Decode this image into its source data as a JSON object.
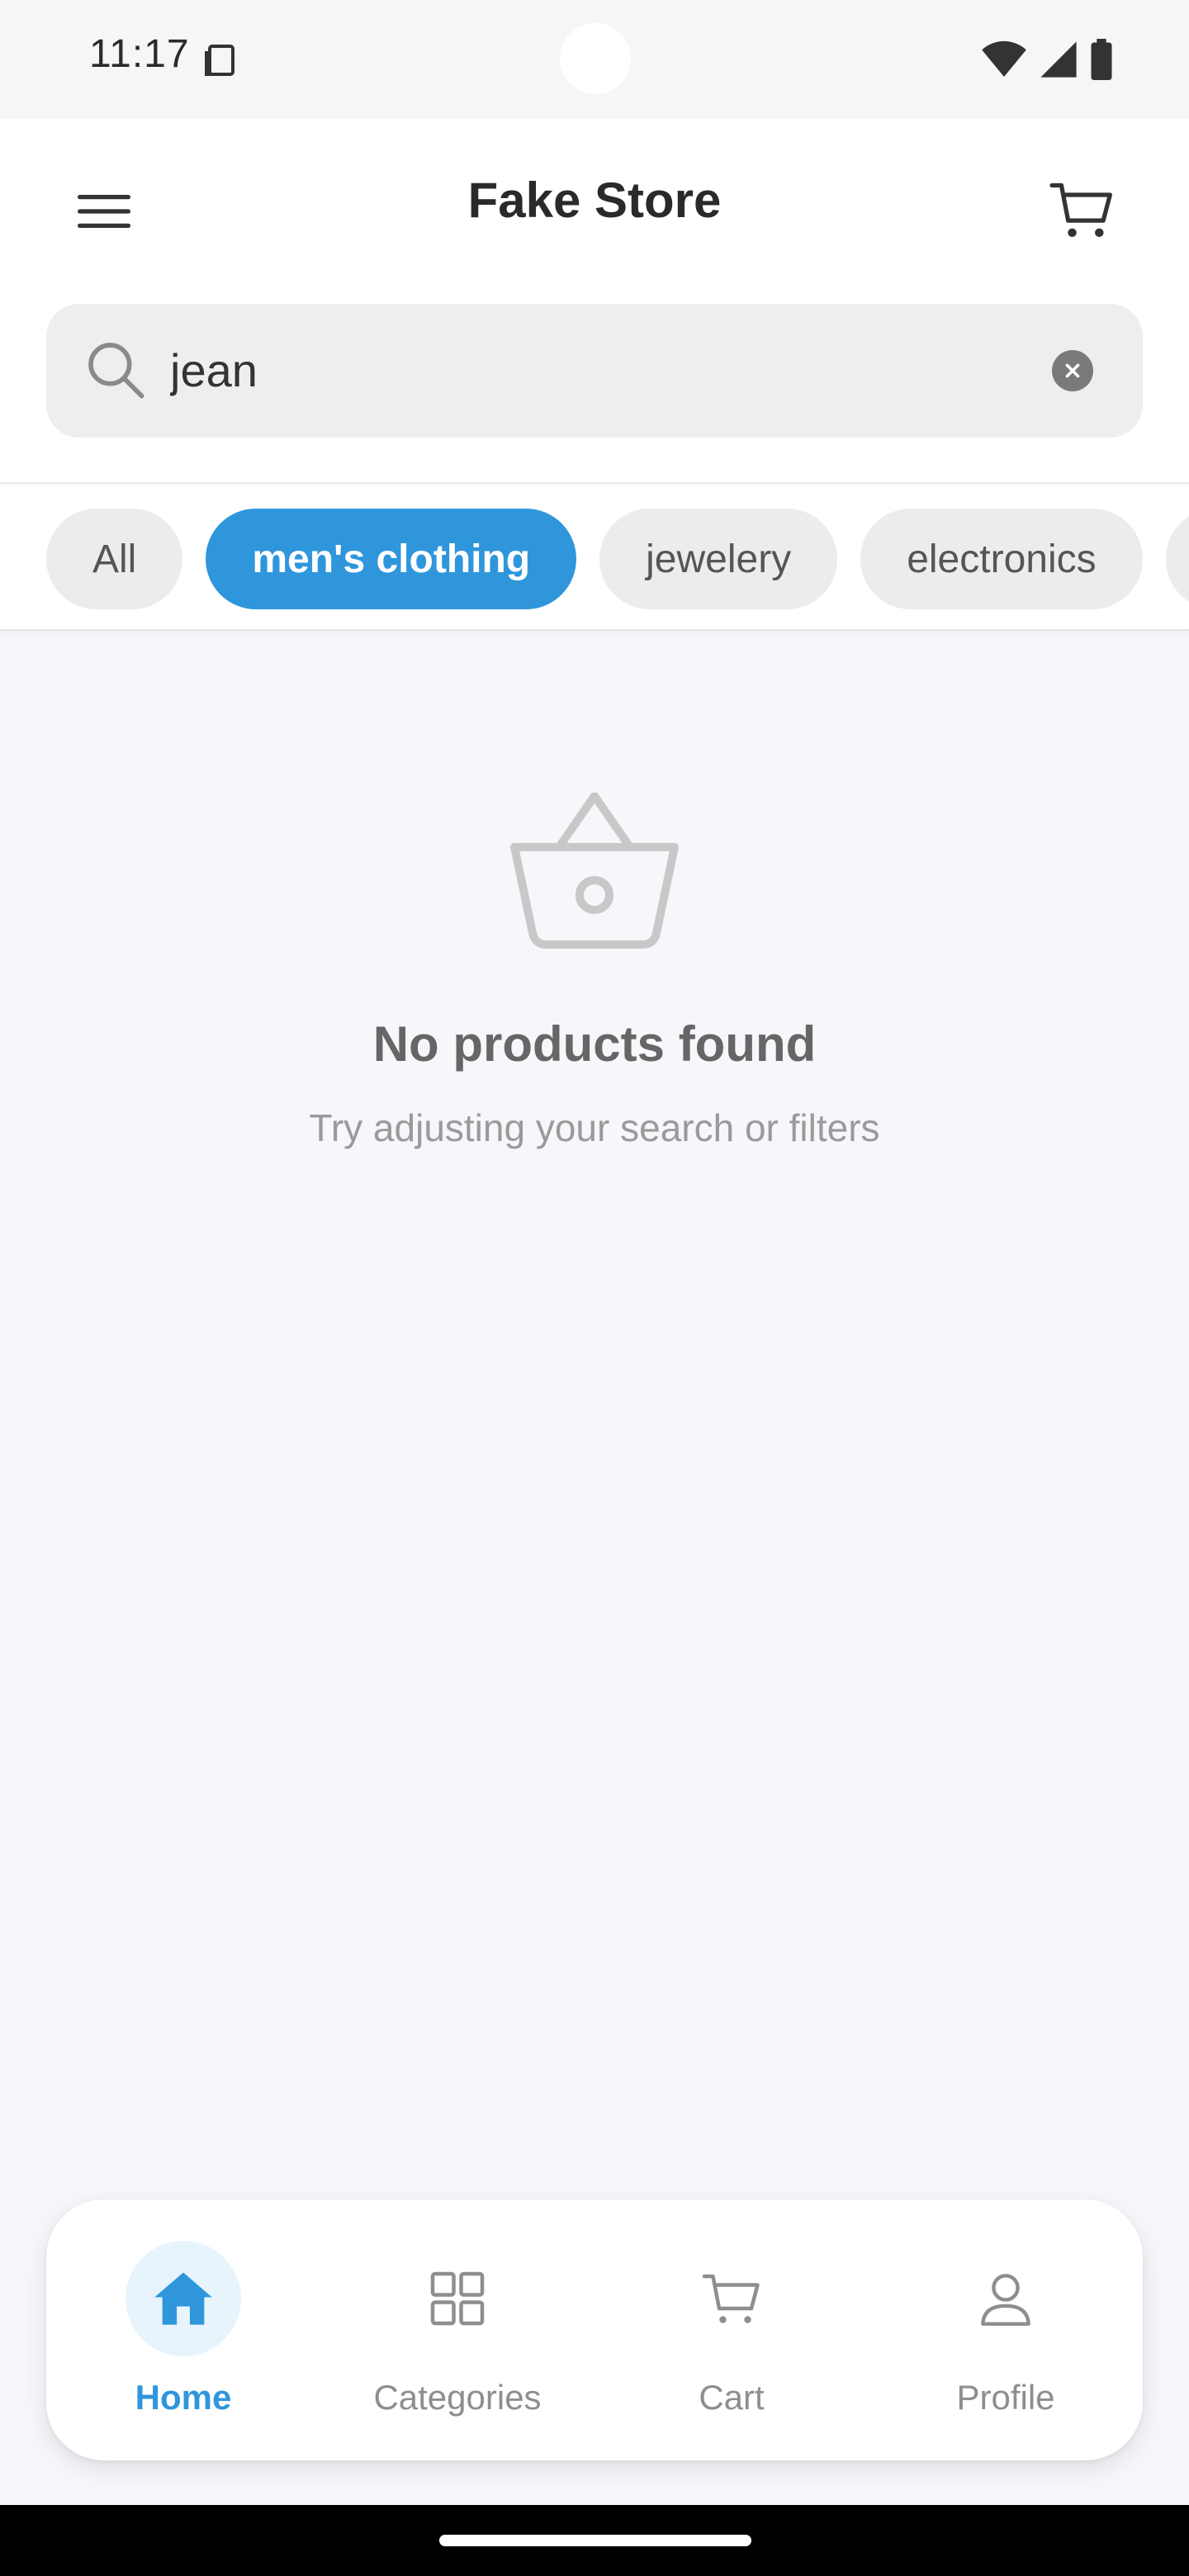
{
  "status_bar": {
    "time": "11:17"
  },
  "header": {
    "title": "Fake Store",
    "menu_icon": "menu-icon",
    "cart_icon": "cart-icon"
  },
  "search": {
    "value": "jean",
    "placeholder": "",
    "search_icon": "search-icon",
    "clear_icon": "clear-icon"
  },
  "filters": {
    "chips": [
      "All",
      "men's clothing",
      "jewelery",
      "electronics"
    ],
    "selected": "men's clothing"
  },
  "empty_state": {
    "icon": "basket-icon",
    "title": "No products found",
    "subtitle": "Try adjusting your search or filters"
  },
  "bottom_nav": {
    "items": [
      {
        "label": "Home",
        "icon": "home-icon",
        "active": true
      },
      {
        "label": "Categories",
        "icon": "grid-icon",
        "active": false
      },
      {
        "label": "Cart",
        "icon": "cart-icon",
        "active": false
      },
      {
        "label": "Profile",
        "icon": "user-icon",
        "active": false
      }
    ]
  },
  "colors": {
    "accent": "#2f96dc",
    "background": "#f5f7fa",
    "chip_inactive": "#ececec"
  }
}
